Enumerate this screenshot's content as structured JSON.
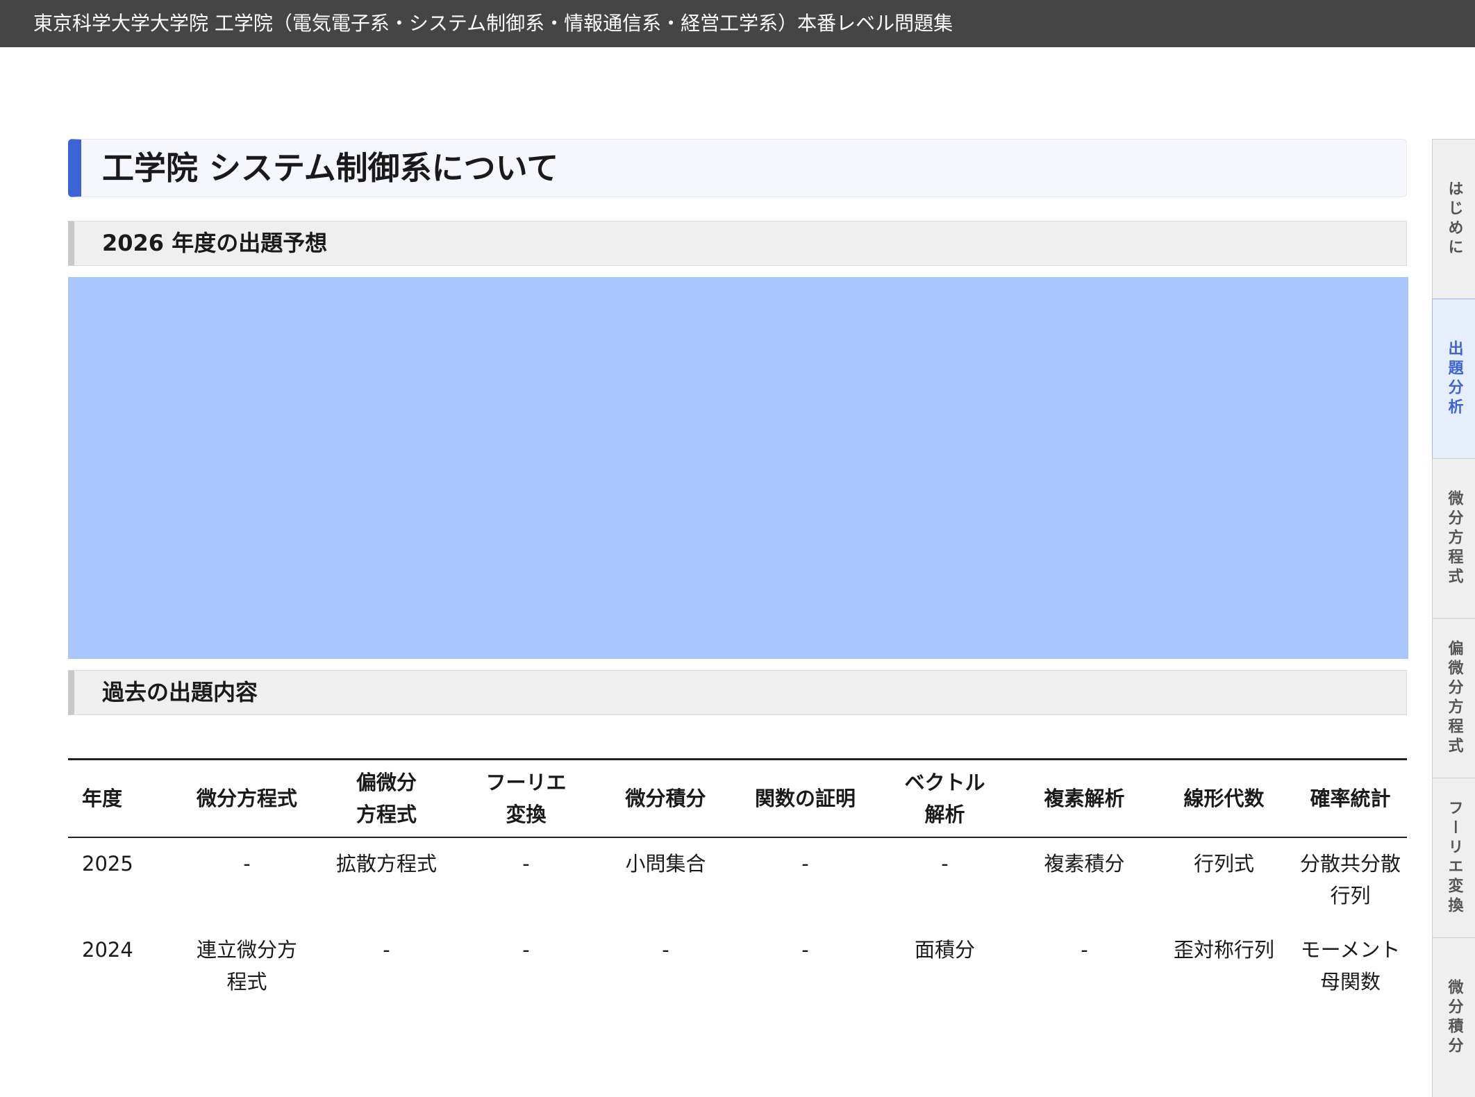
{
  "header": {
    "title": "東京科学大学大学院 工学院（電気電子系・システム制御系・情報通信系・経営工学系）本番レベル問題集"
  },
  "main": {
    "page_title": "工学院 システム制御系について",
    "forecast_heading": "2026 年度の出題予想",
    "past_heading": "過去の出題内容"
  },
  "table": {
    "columns": [
      "年度",
      "微分方程式",
      "偏微分\n方程式",
      "フーリエ\n変換",
      "微分積分",
      "関数の証明",
      "ベクトル\n解析",
      "複素解析",
      "線形代数",
      "確率統計"
    ],
    "rows": [
      [
        "2025",
        "-",
        "拡散方程式",
        "-",
        "小問集合",
        "-",
        "-",
        "複素積分",
        "行列式",
        "分散共分散\n行列"
      ],
      [
        "2024",
        "連立微分方\n程式",
        "-",
        "-",
        "-",
        "-",
        "面積分",
        "-",
        "歪対称行列",
        "モーメント\n母関数"
      ]
    ]
  },
  "sidenav": {
    "tabs": [
      "はじめに",
      "出題分析",
      "微分方程式",
      "偏微分方程式",
      "フーリエ変換",
      "微分積分"
    ],
    "active_index": 1
  },
  "colors": {
    "header_bg": "#454545",
    "accent": "#3c64d6",
    "forecast_box": "#a8c6fc"
  }
}
